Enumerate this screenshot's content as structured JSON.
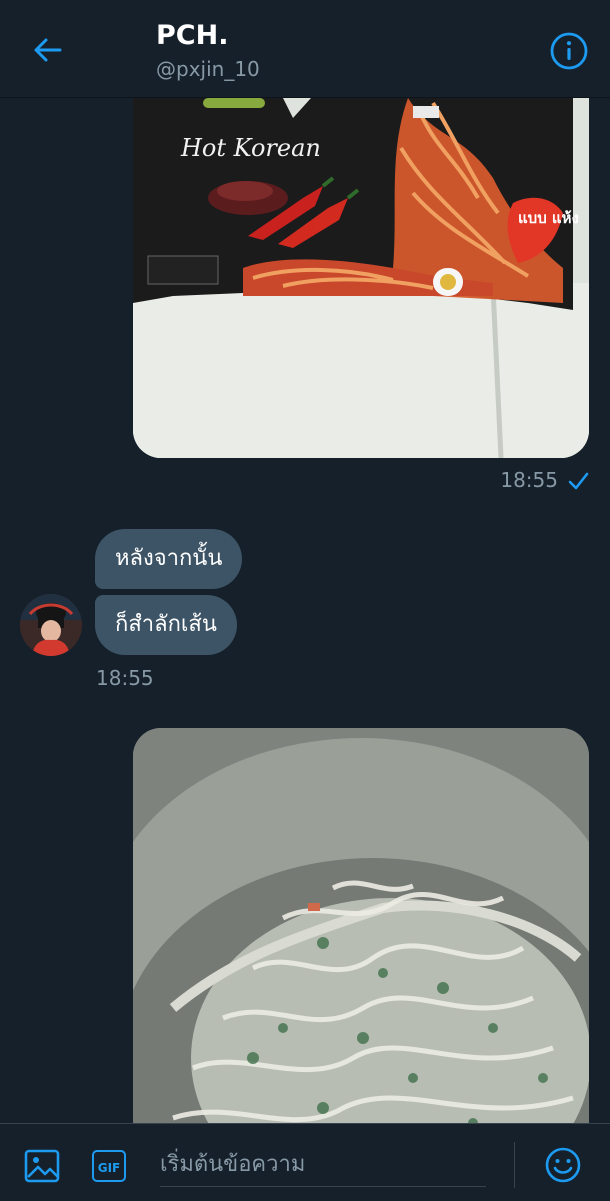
{
  "header": {
    "title": "PCH.",
    "handle": "@pxjin_10",
    "back_icon": "arrow-left-icon",
    "info_icon": "info-icon"
  },
  "messages": [
    {
      "type": "image",
      "direction": "outgoing",
      "image_text": {
        "line1": "Hot Korean",
        "badge": "แบบ แห้ง"
      },
      "time": "18:55",
      "status_icon": "check-icon"
    },
    {
      "type": "text",
      "direction": "incoming",
      "text": "หลังจากนั้น"
    },
    {
      "type": "text",
      "direction": "incoming",
      "text": "ก็สำลักเส้น",
      "time": "18:55"
    },
    {
      "type": "image",
      "direction": "outgoing"
    }
  ],
  "composer": {
    "placeholder": "เริ่มต้นข้อความ",
    "gif_label": "GIF",
    "media_icon": "image-icon",
    "emoji_icon": "smiley-icon"
  },
  "colors": {
    "background": "#15202b",
    "accent": "#1d9bf0",
    "incoming_bubble": "#3d5466",
    "muted_text": "#8899a6"
  }
}
